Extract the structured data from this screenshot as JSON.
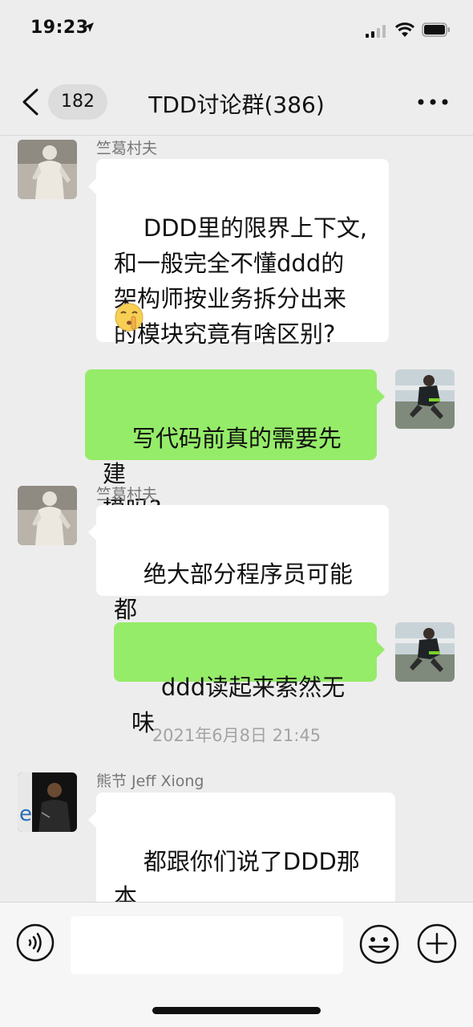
{
  "status_bar": {
    "time": "19:23"
  },
  "nav": {
    "back_count": "182",
    "title": "TDD讨论群(386)"
  },
  "messages": [
    {
      "sender": "竺葛村夫",
      "text": "DDD里的限界上下文,\n和一般完全不懂ddd的\n架构师按业务拆分出来\n的模块究竟有啥区别?",
      "emoji": "shushing-face"
    },
    {
      "text": "写代码前真的需要先建\n模吗?"
    },
    {
      "sender": "竺葛村夫",
      "text": "绝大部分程序员可能都\n没听说过建模"
    },
    {
      "text": "ddd读起来索然无味"
    },
    {
      "timestamp": "2021年6月8日 21:45"
    },
    {
      "sender": "熊节 Jeff Xiong",
      "text": "都跟你们说了DDD那本\n书不是用来指导实践的\n嘛"
    }
  ],
  "colors": {
    "outgoing_bubble": "#95ec69",
    "incoming_bubble": "#ffffff",
    "background": "#ededed"
  }
}
